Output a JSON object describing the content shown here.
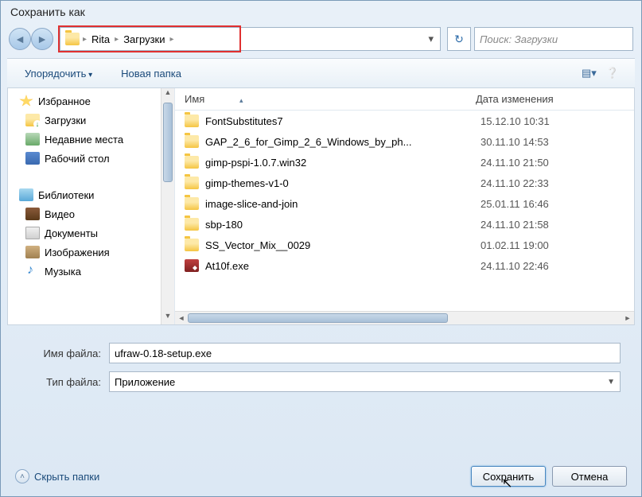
{
  "window": {
    "title": "Сохранить как"
  },
  "nav": {
    "breadcrumb": [
      "Rita",
      "Загрузки"
    ],
    "search_placeholder": "Поиск: Загрузки"
  },
  "toolbar": {
    "organize": "Упорядочить",
    "new_folder": "Новая папка"
  },
  "sidebar": {
    "favorites": {
      "label": "Избранное"
    },
    "items1": [
      {
        "label": "Загрузки",
        "icon": "folder-dl"
      },
      {
        "label": "Недавние места",
        "icon": "recent-icon"
      },
      {
        "label": "Рабочий стол",
        "icon": "desktop-icon"
      }
    ],
    "libraries": {
      "label": "Библиотеки"
    },
    "items2": [
      {
        "label": "Видео",
        "icon": "video-icon"
      },
      {
        "label": "Документы",
        "icon": "doc-icon"
      },
      {
        "label": "Изображения",
        "icon": "image-icon"
      },
      {
        "label": "Музыка",
        "icon": "music-icon"
      }
    ]
  },
  "columns": {
    "name": "Имя",
    "date": "Дата изменения"
  },
  "files": [
    {
      "name": "FontSubstitutes7",
      "date": "15.12.10 10:31",
      "type": "folder"
    },
    {
      "name": "GAP_2_6_for_Gimp_2_6_Windows_by_ph...",
      "date": "30.11.10 14:53",
      "type": "folder"
    },
    {
      "name": "gimp-pspi-1.0.7.win32",
      "date": "24.11.10 21:50",
      "type": "folder"
    },
    {
      "name": "gimp-themes-v1-0",
      "date": "24.11.10 22:33",
      "type": "folder"
    },
    {
      "name": "image-slice-and-join",
      "date": "25.01.11 16:46",
      "type": "folder"
    },
    {
      "name": "sbp-180",
      "date": "24.11.10 21:58",
      "type": "folder"
    },
    {
      "name": "SS_Vector_Mix__0029",
      "date": "01.02.11 19:00",
      "type": "folder"
    },
    {
      "name": "At10f.exe",
      "date": "24.11.10 22:46",
      "type": "exe"
    }
  ],
  "fields": {
    "filename_label": "Имя файла:",
    "filename_value": "ufraw-0.18-setup.exe",
    "filetype_label": "Тип файла:",
    "filetype_value": "Приложение"
  },
  "footer": {
    "hide_folders": "Скрыть папки",
    "save": "Сохранить",
    "cancel": "Отмена"
  }
}
